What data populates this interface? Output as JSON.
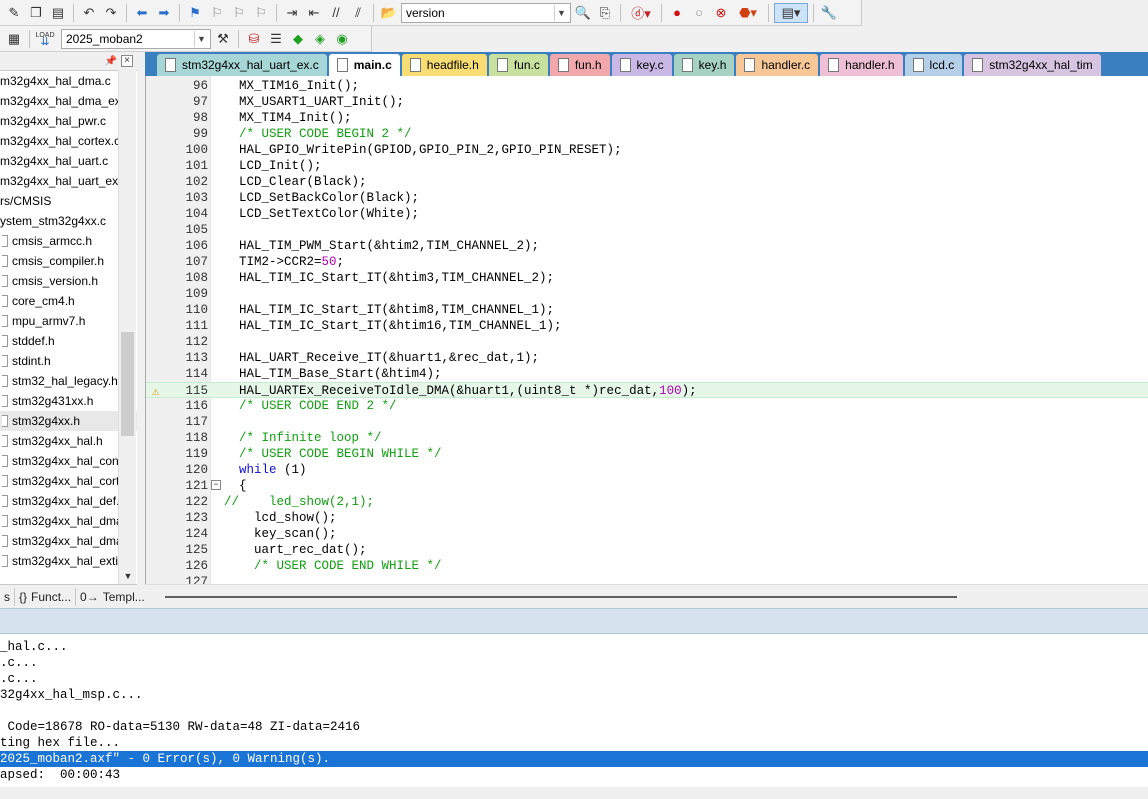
{
  "toolbar1": {
    "find_combo_value": "version",
    "buttons": [
      "new-file",
      "open-file",
      "save-file",
      "undo",
      "redo",
      "nav-back",
      "nav-forward",
      "bookmark",
      "bookmark-prev",
      "bookmark-next",
      "bookmark-clear",
      "indent",
      "unindent",
      "comment",
      "uncomment",
      "find-in-files",
      "debug-session",
      "breakpoint",
      "breakpoint-disable",
      "breakpoint-kill",
      "breakpoint-enable",
      "window-layout",
      "configure"
    ]
  },
  "toolbar2": {
    "target_value": "2025_moban2",
    "load_label": "LOAD"
  },
  "project_tree": {
    "items": [
      {
        "label": "m32g4xx_hal_dma.c",
        "file": false
      },
      {
        "label": "m32g4xx_hal_dma_ex.",
        "file": false
      },
      {
        "label": "m32g4xx_hal_pwr.c",
        "file": false
      },
      {
        "label": "m32g4xx_hal_cortex.c",
        "file": false
      },
      {
        "label": "m32g4xx_hal_uart.c",
        "file": false
      },
      {
        "label": "m32g4xx_hal_uart_ex.c",
        "file": false
      },
      {
        "label": "rs/CMSIS",
        "file": false
      },
      {
        "label": "ystem_stm32g4xx.c",
        "file": false
      },
      {
        "label": "cmsis_armcc.h",
        "file": true
      },
      {
        "label": "cmsis_compiler.h",
        "file": true
      },
      {
        "label": "cmsis_version.h",
        "file": true
      },
      {
        "label": "core_cm4.h",
        "file": true
      },
      {
        "label": "mpu_armv7.h",
        "file": true
      },
      {
        "label": "stddef.h",
        "file": true
      },
      {
        "label": "stdint.h",
        "file": true
      },
      {
        "label": "stm32_hal_legacy.h",
        "file": true
      },
      {
        "label": "stm32g431xx.h",
        "file": true
      },
      {
        "label": "stm32g4xx.h",
        "file": true,
        "selected": true
      },
      {
        "label": "stm32g4xx_hal.h",
        "file": true
      },
      {
        "label": "stm32g4xx_hal_conf",
        "file": true
      },
      {
        "label": "stm32g4xx_hal_corte",
        "file": true
      },
      {
        "label": "stm32g4xx_hal_def.h",
        "file": true
      },
      {
        "label": "stm32g4xx_hal_dma",
        "file": true
      },
      {
        "label": "stm32g4xx_hal_dma",
        "file": true
      },
      {
        "label": "stm32g4xx_hal_exti.",
        "file": true
      }
    ],
    "tabs": [
      {
        "icon": "",
        "label": "s"
      },
      {
        "icon": "{}",
        "label": "Funct..."
      },
      {
        "icon": "0→",
        "label": "Templ..."
      }
    ]
  },
  "editor": {
    "tabs": [
      {
        "label": "stm32g4xx_hal_uart_ex.c",
        "color": "#a6d7d6",
        "active": false
      },
      {
        "label": "main.c",
        "color": "#ffffff",
        "active": true
      },
      {
        "label": "headfile.h",
        "color": "#f8dd74",
        "active": false
      },
      {
        "label": "fun.c",
        "color": "#c9e19e",
        "active": false
      },
      {
        "label": "fun.h",
        "color": "#f2a7ad",
        "active": false
      },
      {
        "label": "key.c",
        "color": "#c9b8e6",
        "active": false
      },
      {
        "label": "key.h",
        "color": "#a6d2c4",
        "active": false
      },
      {
        "label": "handler.c",
        "color": "#f7c797",
        "active": false
      },
      {
        "label": "handler.h",
        "color": "#efbfd6",
        "active": false
      },
      {
        "label": "lcd.c",
        "color": "#b6cfe9",
        "active": false
      },
      {
        "label": "stm32g4xx_hal_tim",
        "color": "#d6c4e0",
        "active": false
      }
    ],
    "lines": [
      {
        "n": "96",
        "text": "  MX_TIM16_Init();",
        "type": "code"
      },
      {
        "n": "97",
        "text": "  MX_USART1_UART_Init();",
        "type": "code"
      },
      {
        "n": "98",
        "text": "  MX_TIM4_Init();",
        "type": "code"
      },
      {
        "n": "99",
        "text": "  /* USER CODE BEGIN 2 */",
        "type": "comment"
      },
      {
        "n": "100",
        "text": "  HAL_GPIO_WritePin(GPIOD,GPIO_PIN_2,GPIO_PIN_RESET);",
        "type": "code"
      },
      {
        "n": "101",
        "text": "  LCD_Init();",
        "type": "code"
      },
      {
        "n": "102",
        "text": "  LCD_Clear(Black);",
        "type": "code"
      },
      {
        "n": "103",
        "text": "  LCD_SetBackColor(Black);",
        "type": "code"
      },
      {
        "n": "104",
        "text": "  LCD_SetTextColor(White);",
        "type": "code"
      },
      {
        "n": "105",
        "text": "",
        "type": "code"
      },
      {
        "n": "106",
        "text": "  HAL_TIM_PWM_Start(&htim2,TIM_CHANNEL_2);",
        "type": "code"
      },
      {
        "n": "107",
        "text": "  TIM2->CCR2=",
        "num": "50",
        "tail": ";",
        "type": "code"
      },
      {
        "n": "108",
        "text": "  HAL_TIM_IC_Start_IT(&htim3,TIM_CHANNEL_2);",
        "type": "code"
      },
      {
        "n": "109",
        "text": "",
        "type": "code"
      },
      {
        "n": "110",
        "text": "  HAL_TIM_IC_Start_IT(&htim8,TIM_CHANNEL_1);",
        "type": "code"
      },
      {
        "n": "111",
        "text": "  HAL_TIM_IC_Start_IT(&htim16,TIM_CHANNEL_1);",
        "type": "code"
      },
      {
        "n": "112",
        "text": "",
        "type": "code"
      },
      {
        "n": "113",
        "text": "  HAL_UART_Receive_IT(&huart1,&rec_dat,1);",
        "type": "code"
      },
      {
        "n": "114",
        "text": "  HAL_TIM_Base_Start(&htim4);",
        "type": "code"
      },
      {
        "n": "115",
        "text": "  HAL_UARTEx_ReceiveToIdle_DMA(&huart1,(uint8_t *)rec_dat,",
        "num": "100",
        "tail": ");",
        "type": "code",
        "current": true,
        "warning": true
      },
      {
        "n": "116",
        "text": "  /* USER CODE END 2 */",
        "type": "comment"
      },
      {
        "n": "117",
        "text": "",
        "type": "code"
      },
      {
        "n": "118",
        "text": "  /* Infinite loop */",
        "type": "comment"
      },
      {
        "n": "119",
        "text": "  /* USER CODE BEGIN WHILE */",
        "type": "comment"
      },
      {
        "n": "120",
        "text": "  ",
        "kw": "while",
        "tail": " (1)",
        "type": "code"
      },
      {
        "n": "121",
        "text": "  {",
        "type": "code",
        "fold": true
      },
      {
        "n": "122",
        "text": "//    led_show(2,1);",
        "type": "comment"
      },
      {
        "n": "123",
        "text": "    lcd_show();",
        "type": "code"
      },
      {
        "n": "124",
        "text": "    key_scan();",
        "type": "code"
      },
      {
        "n": "125",
        "text": "    uart_rec_dat();",
        "type": "code"
      },
      {
        "n": "126",
        "text": "    /* USER CODE END WHILE */",
        "type": "comment"
      },
      {
        "n": "127",
        "text": "",
        "type": "code"
      }
    ]
  },
  "build_output": {
    "lines": [
      {
        "text": "_hal.c...",
        "hl": false
      },
      {
        "text": ".c...",
        "hl": false
      },
      {
        "text": ".c...",
        "hl": false
      },
      {
        "text": "32g4xx_hal_msp.c...",
        "hl": false
      },
      {
        "text": "",
        "hl": false
      },
      {
        "text": " Code=18678 RO-data=5130 RW-data=48 ZI-data=2416",
        "hl": false
      },
      {
        "text": "ting hex file...",
        "hl": false
      },
      {
        "text": "2025_moban2.axf\" - 0 Error(s), 0 Warning(s).",
        "hl": true
      },
      {
        "text": "apsed:  00:00:43",
        "hl": false
      }
    ]
  },
  "colors": {
    "tab_bar": "#3a7fc0",
    "current_line": "#e6f6e9",
    "comment": "#10a010",
    "keyword": "#1010d0",
    "number": "#b000b0",
    "build_highlight": "#1a74d6"
  }
}
